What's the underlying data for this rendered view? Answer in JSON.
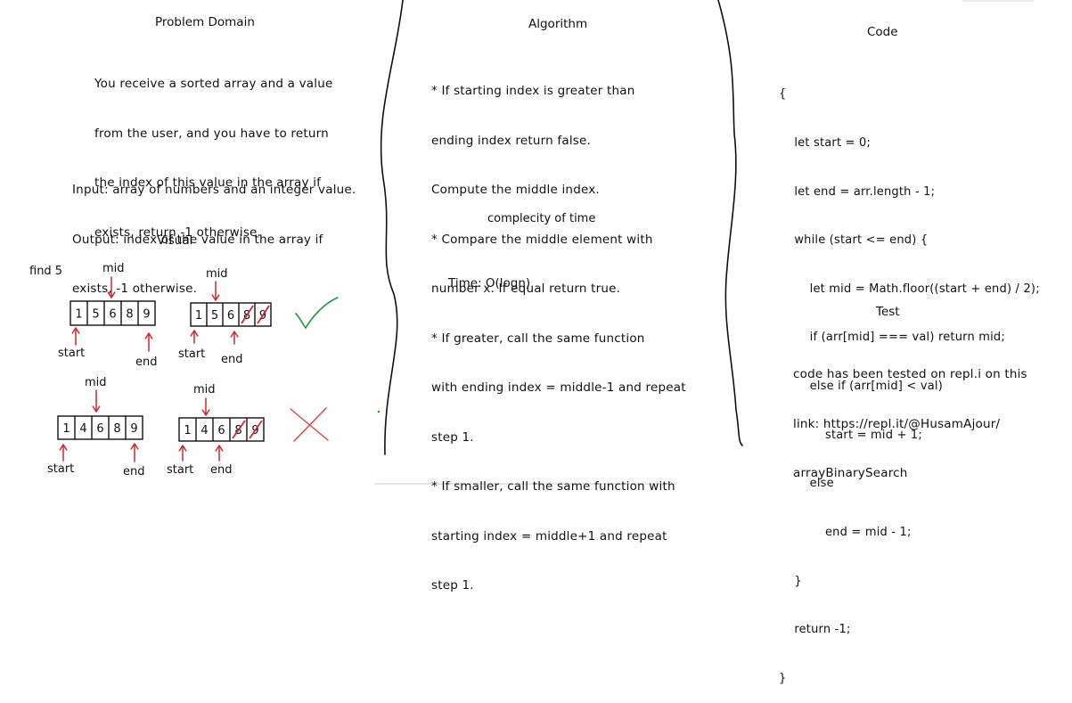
{
  "problem_domain": {
    "title": "Problem Domain",
    "description_lines": [
      "You receive a sorted array and a value",
      "from the user, and you have to return",
      "the index of this value in the array if",
      "exists, return -1 otherwise."
    ],
    "io_lines": [
      "Input: array of numbers and an integer value.",
      "Output: index of the value in the array if",
      "exists, -1 otherwise."
    ]
  },
  "visual": {
    "title": "Visual",
    "find_label": "find 5",
    "mid_label": "mid",
    "start_label": "start",
    "end_label": "end",
    "array_top": [
      "1",
      "5",
      "6",
      "8",
      "9"
    ],
    "array_bottom": [
      "1",
      "4",
      "6",
      "8",
      "9"
    ],
    "check_color": "#1f9a3c",
    "cross_color": "#e0433f",
    "strike_color": "#d6262b",
    "arrow_color": "#d6262b"
  },
  "algorithm": {
    "title": "Algorithm",
    "lines": [
      "* If starting index is greater than",
      "ending index return false.",
      "Compute the middle index.",
      "* Compare the middle element with",
      "number x. If equal return true.",
      "* If greater, call the same function",
      "with ending index = middle-1 and repeat",
      "step 1.",
      "* If smaller, call the same function with",
      "starting index = middle+1 and repeat",
      "step 1."
    ],
    "note": "complecity of time",
    "time": "Time: O(logn)"
  },
  "code": {
    "title": "Code",
    "lines": [
      "{",
      "    let start = 0;",
      "    let end = arr.length - 1;",
      "    while (start <= end) {",
      "        let mid = Math.floor((start + end) / 2);",
      "        if (arr[mid] === val) return mid;",
      "        else if (arr[mid] < val)",
      "            start = mid + 1;",
      "        else",
      "            end = mid - 1;",
      "    }",
      "    return -1;",
      "}"
    ]
  },
  "test": {
    "title": "Test",
    "lines": [
      "code has been tested on repl.i on this",
      "link: https://repl.it/@HusamAjour/",
      "arrayBinarySearch"
    ]
  }
}
